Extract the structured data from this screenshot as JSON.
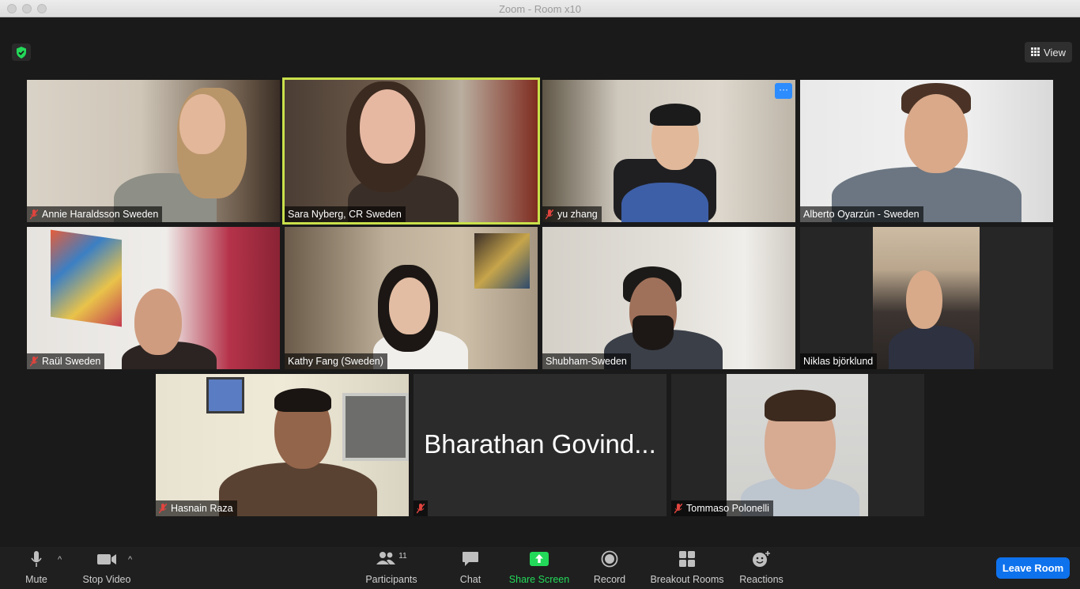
{
  "window": {
    "title": "Zoom - Room x10"
  },
  "header": {
    "view_label": "View"
  },
  "participants": [
    {
      "name": "Annie Haraldsson Sweden",
      "muted": true
    },
    {
      "name": "Sara Nyberg, CR Sweden",
      "muted": false,
      "active_speaker": true
    },
    {
      "name": "yu zhang",
      "muted": true
    },
    {
      "name": "Alberto Oyarzún - Sweden",
      "muted": false
    },
    {
      "name": "Raül Sweden",
      "muted": true
    },
    {
      "name": "Kathy Fang (Sweden)",
      "muted": false
    },
    {
      "name": "Shubham-Sweden",
      "muted": false
    },
    {
      "name": "Niklas björklund",
      "muted": false
    },
    {
      "name": "Hasnain Raza",
      "muted": true
    },
    {
      "name": "",
      "display_name_large": "Bharathan Govind...",
      "muted": true,
      "video_off": true
    },
    {
      "name": "Tommaso Polonelli",
      "muted": true
    }
  ],
  "toolbar": {
    "mute_label": "Mute",
    "video_label": "Stop Video",
    "participants_label": "Participants",
    "participants_count": "11",
    "chat_label": "Chat",
    "share_label": "Share Screen",
    "record_label": "Record",
    "breakout_label": "Breakout Rooms",
    "reactions_label": "Reactions",
    "leave_label": "Leave Room"
  },
  "colors": {
    "active_speaker_border": "#c9e04b",
    "share_green": "#23d959",
    "leave_blue": "#0e72ed",
    "muted_red": "#e0443e"
  }
}
